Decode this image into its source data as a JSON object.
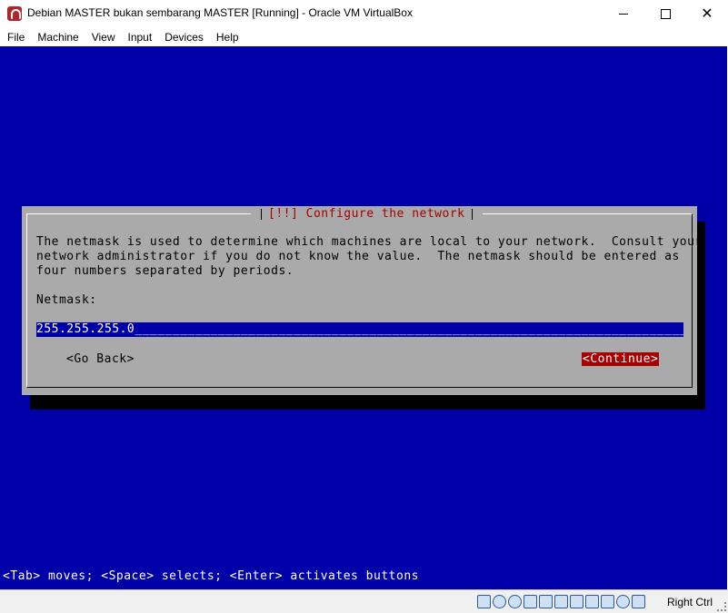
{
  "window": {
    "title": "Debian MASTER bukan sembarang MASTER [Running] - Oracle VM VirtualBox",
    "minimize_glyph": "",
    "maximize_glyph": "",
    "close_glyph": "✕"
  },
  "menubar": {
    "items": [
      "File",
      "Machine",
      "View",
      "Input",
      "Devices",
      "Help"
    ]
  },
  "installer": {
    "dialog_title": "[!!] Configure the network",
    "description": "The netmask is used to determine which machines are local to your network.  Consult your\nnetwork administrator if you do not know the value.  The netmask should be entered as\nfour numbers separated by periods.",
    "netmask_label": "Netmask:",
    "netmask_value": "255.255.255.0",
    "go_back_label": "<Go Back>",
    "continue_label": "<Continue>",
    "help_text": "<Tab> moves; <Space> selects; <Enter> activates buttons"
  },
  "statusbar": {
    "host_key": "Right Ctrl",
    "icons": [
      "hard-disk-icon",
      "optical-drive-icon",
      "audio-icon",
      "network-icon",
      "usb-icon",
      "shared-folders-icon",
      "display-icon",
      "video-capture-icon",
      "cpu-icon",
      "mouse-integration-icon",
      "keyboard-icon"
    ]
  },
  "colors": {
    "vm_background": "#0000a8",
    "dialog_background": "#aaaaaa",
    "accent_red": "#a80000"
  }
}
